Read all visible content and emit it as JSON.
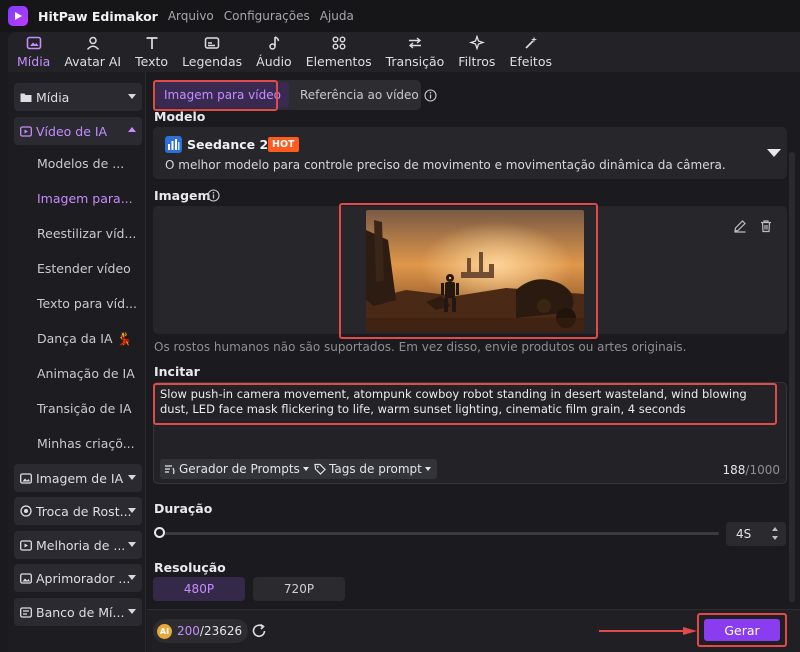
{
  "app": {
    "name": "HitPaw Edimakor",
    "menu": [
      "Arquivo",
      "Configurações",
      "Ajuda"
    ]
  },
  "toolbar": {
    "items": [
      {
        "label": "Mídia",
        "icon": "media-icon",
        "active": true
      },
      {
        "label": "Avatar AI",
        "icon": "avatar-icon"
      },
      {
        "label": "Texto",
        "icon": "text-icon"
      },
      {
        "label": "Legendas",
        "icon": "captions-icon"
      },
      {
        "label": "Áudio",
        "icon": "audio-icon"
      },
      {
        "label": "Elementos",
        "icon": "elements-icon"
      },
      {
        "label": "Transição",
        "icon": "transition-icon"
      },
      {
        "label": "Filtros",
        "icon": "filters-icon"
      },
      {
        "label": "Efeitos",
        "icon": "effects-icon"
      }
    ]
  },
  "sidebar": {
    "groups": [
      {
        "label": "Mídia",
        "icon": "folder-icon"
      },
      {
        "label": "Vídeo de IA",
        "icon": "ai-video-icon",
        "active": true
      },
      {
        "label": "Imagem de IA",
        "icon": "ai-image-icon"
      },
      {
        "label": "Troca de Rost...",
        "icon": "face-swap-icon"
      },
      {
        "label": "Melhoria de ...",
        "icon": "enhance-icon"
      },
      {
        "label": "Aprimorador ...",
        "icon": "enhancer-icon"
      },
      {
        "label": "Banco de Mí...",
        "icon": "media-bank-icon"
      }
    ],
    "sub_items": [
      "Modelos de ...",
      "Imagem para...",
      "Reestilizar víd...",
      "Estender vídeo",
      "Texto para víd...",
      "Dança da IA 💃",
      "Animação de IA",
      "Transição de IA",
      "Minhas criaçõ..."
    ]
  },
  "tabs": {
    "active": "Imagem para vídeo",
    "other": "Referência ao vídeo"
  },
  "model": {
    "section_label": "Modelo",
    "name": "Seedance 2.0",
    "badge": "HOT",
    "description": "O melhor modelo para controle preciso de movimento e movimentação dinâmica da câmera."
  },
  "image": {
    "section_label": "Imagem",
    "hint": "Os rostos humanos não são suportados. Em vez disso, envie produtos ou artes originais."
  },
  "prompt": {
    "section_label": "Incitar",
    "text": "Slow push-in camera movement, atompunk cowboy robot standing in desert wasteland, wind blowing dust, LED face mask flickering to life, warm sunset lighting, cinematic film grain, 4 seconds",
    "generator_label": "Gerador de Prompts",
    "tags_label": "Tags de prompt",
    "count": "188",
    "max": "/1000"
  },
  "duration": {
    "section_label": "Duração",
    "value": "4S",
    "slider_fraction": 0
  },
  "resolution": {
    "section_label": "Resolução",
    "options": [
      "480P",
      "720P"
    ],
    "selected": "480P"
  },
  "footer": {
    "coin_label": "AI",
    "credits_used": "200",
    "credits_total": "/23626",
    "generate_label": "Gerar"
  },
  "colors": {
    "accent": "#c58cff",
    "generate": "#8a3cf0",
    "highlight": "#e14a4a",
    "hot_badge": "#ff5a1f"
  }
}
